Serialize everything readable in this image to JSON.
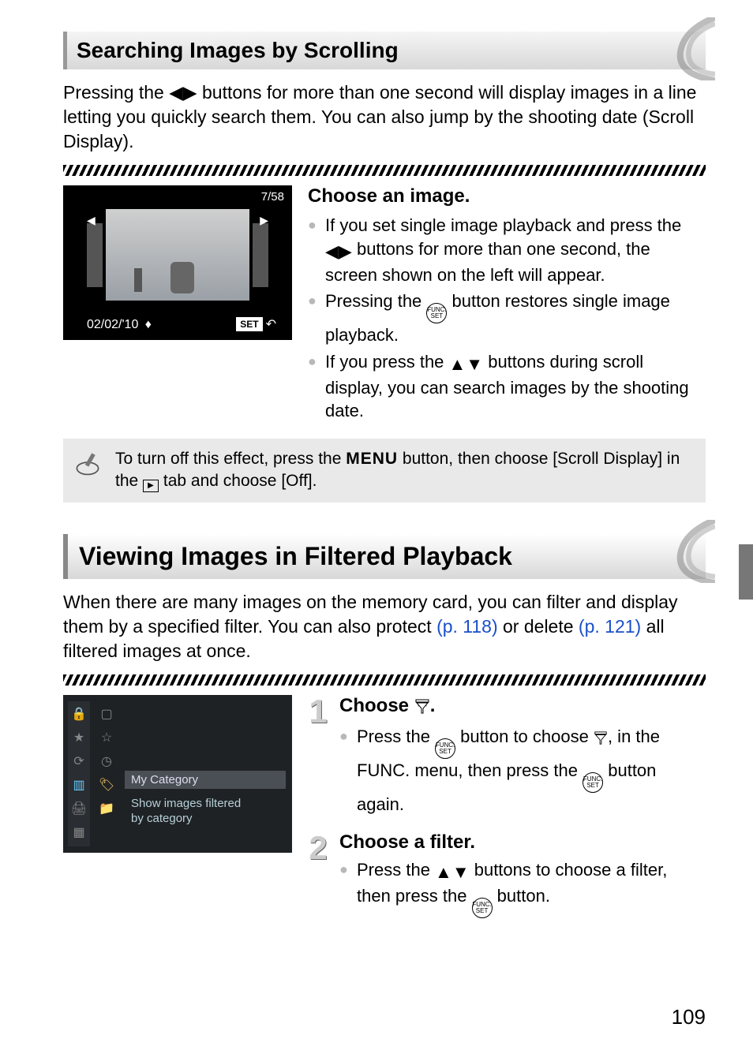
{
  "section1": {
    "title": "Searching Images by Scrolling",
    "intro": "Pressing the ◀▶ buttons for more than one second will display images in a line letting you quickly search them. You can also jump by the shooting date (Scroll Display).",
    "screenshot": {
      "counter": "7/58",
      "date": "02/02/'10",
      "set_label": "SET"
    },
    "subheading": "Choose an image.",
    "bullets": {
      "b1a": "If you set single image playback and press the ",
      "b1b": " buttons for more than one second, the screen shown on the left will appear.",
      "b2a": "Pressing the ",
      "b2b": " button restores single image playback.",
      "b3a": "If you press the ",
      "b3b": " buttons during scroll display, you can search images by the shooting date."
    },
    "note": {
      "a": "To turn off this effect, press the ",
      "menu": "MENU",
      "b": " button, then choose [Scroll Display] in the ",
      "c": " tab and choose [Off]."
    }
  },
  "section2": {
    "title": "Viewing Images in Filtered Playback",
    "intro_a": "When there are many images on the memory card, you can filter and display them by a specified filter. You can also protect ",
    "link1": "(p. 118)",
    "intro_b": " or delete ",
    "link2": "(p. 121)",
    "intro_c": " all filtered images at once.",
    "screenshot": {
      "item": "My Category",
      "desc1": "Show images filtered",
      "desc2": "by category"
    },
    "step1": {
      "num": "1",
      "title_a": "Choose ",
      "title_b": ".",
      "body_a": "Press the ",
      "body_b": " button to choose ",
      "body_c": ", in the FUNC. menu, then press the ",
      "body_d": " button again."
    },
    "step2": {
      "num": "2",
      "title": "Choose a filter.",
      "body_a": "Press the ",
      "body_b": " buttons to choose a filter, then press the ",
      "body_c": " button."
    }
  },
  "page_number": "109",
  "icons": {
    "func": "FUNC.",
    "set": "SET"
  }
}
